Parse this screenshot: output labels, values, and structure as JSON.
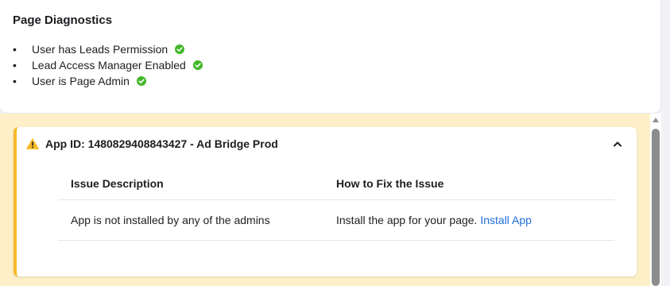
{
  "diagnostics": {
    "title": "Page Diagnostics",
    "items": [
      {
        "label": "User has Leads Permission",
        "status": "check-icon"
      },
      {
        "label": "Lead Access Manager Enabled",
        "status": "check-icon"
      },
      {
        "label": "User is Page Admin",
        "status": "check-icon"
      }
    ],
    "bullet": "•"
  },
  "issue": {
    "title": "App ID: 1480829408843427 - Ad Bridge Prod",
    "headers": {
      "description": "Issue Description",
      "fix": "How to Fix the Issue"
    },
    "row": {
      "description": "App is not installed by any of the admins",
      "fix_text": "Install the app for your page. ",
      "fix_link": "Install App"
    }
  },
  "colors": {
    "check_green": "#42b72a",
    "warning_yellow": "#f7b928",
    "warning_bg": "#fdefc7",
    "link_blue": "#216fdb"
  }
}
